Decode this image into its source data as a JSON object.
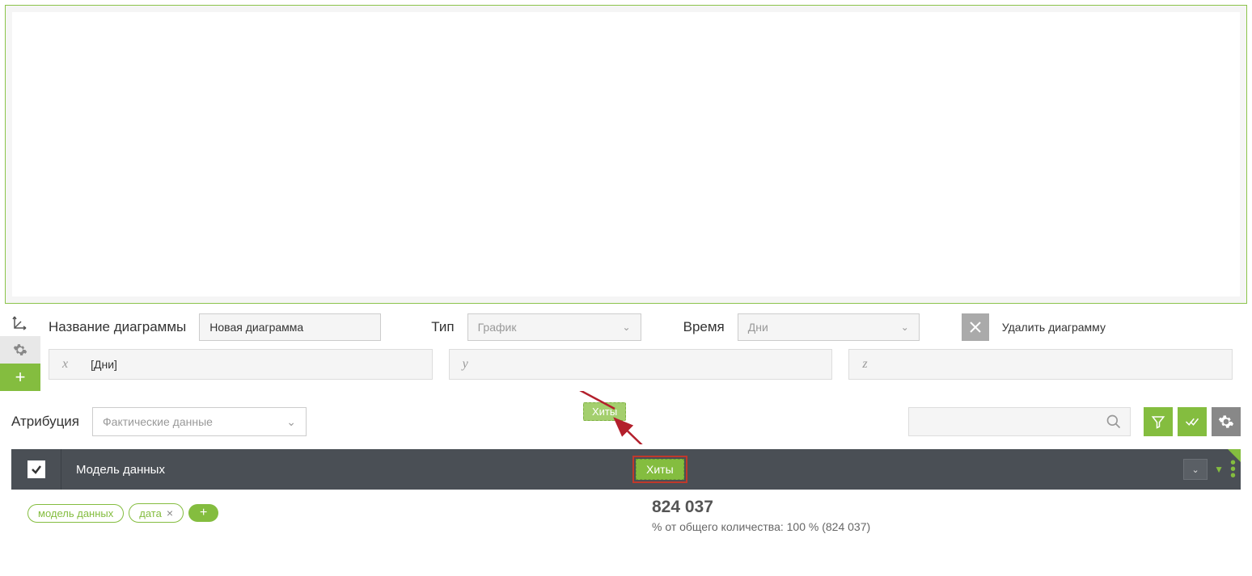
{
  "chart": {
    "title_label": "Название диаграммы",
    "title_value": "Новая диаграмма",
    "type_label": "Тип",
    "type_value": "График",
    "time_label": "Время",
    "time_value": "Дни",
    "delete_label": "Удалить диаграмму"
  },
  "axes": {
    "x_letter": "x",
    "x_value": "[Дни]",
    "y_letter": "y",
    "y_value": "",
    "z_letter": "z",
    "z_value": ""
  },
  "attribution": {
    "label": "Атрибуция",
    "value": "Фактические данные"
  },
  "floating_hits": "Хиты",
  "table": {
    "model_label": "Модель данных",
    "hits_label": "Хиты"
  },
  "tags": {
    "model": "модель данных",
    "date": "дата"
  },
  "result": {
    "count": "824 037",
    "percent_text": "% от общего количества: 100 % (824 037)"
  }
}
